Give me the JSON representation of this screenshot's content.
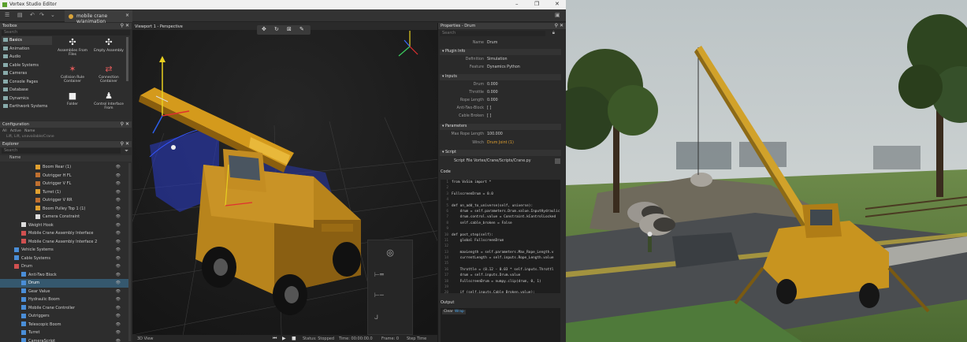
{
  "app": {
    "title": "Vortex Studio Editor",
    "window_controls": [
      "–",
      "❐",
      "✕"
    ]
  },
  "document_tab": {
    "label": "mobile crane w/animation",
    "close": "×"
  },
  "toolbox": {
    "title": "Toolbox",
    "search_placeholder": "Search",
    "categories": [
      "Basics",
      "Animation",
      "Audio",
      "Cable Systems",
      "Cameras",
      "Console Pages",
      "Database",
      "Dynamics",
      "Earthwork Systems"
    ],
    "items": [
      {
        "label": "Assemblies From Files"
      },
      {
        "label": "Empty Assembly"
      },
      {
        "label": "Collision Rule Container"
      },
      {
        "label": "Connection Container"
      },
      {
        "label": "Folder"
      },
      {
        "label": "Control Interface From"
      }
    ]
  },
  "configuration": {
    "title": "Configuration",
    "tabs": [
      "All",
      "Active",
      "Name"
    ],
    "row": "Lift, Lift, unavailable/Crane"
  },
  "explorer": {
    "title": "Explorer",
    "search_placeholder": "Search",
    "column_name": "Name",
    "rows": [
      {
        "label": "Boom Rear (1)",
        "indent": 5,
        "icon": "#e0a030"
      },
      {
        "label": "Outrigger H FL",
        "indent": 5,
        "icon": "#c07030"
      },
      {
        "label": "Outrigger V FL",
        "indent": 5,
        "icon": "#c07030"
      },
      {
        "label": "Turret (1)",
        "indent": 5,
        "icon": "#e0a030"
      },
      {
        "label": "Outrigger V RR",
        "indent": 5,
        "icon": "#c07030"
      },
      {
        "label": "Boom Pulley Top 1 (1)",
        "indent": 5,
        "icon": "#e0a030"
      },
      {
        "label": "Camera Constraint",
        "indent": 5,
        "icon": "#dddddd"
      },
      {
        "label": "Weight Hook",
        "indent": 3,
        "icon": "#dddddd"
      },
      {
        "label": "Mobile Crane Assembly Interface",
        "indent": 3,
        "icon": "#d05050"
      },
      {
        "label": "Mobile Crane Assembly Interface 2",
        "indent": 3,
        "icon": "#d05050"
      },
      {
        "label": "Vehicle Systems",
        "indent": 2,
        "icon": "#4a8ed8"
      },
      {
        "label": "Cable Systems",
        "indent": 2,
        "icon": "#4a8ed8"
      },
      {
        "label": "Drum",
        "indent": 2,
        "icon": "#d05050"
      },
      {
        "label": "Anti-Two Block",
        "indent": 3,
        "icon": "#4a8ed8"
      },
      {
        "label": "Drum",
        "indent": 3,
        "icon": "#4a8ed8",
        "selected": true
      },
      {
        "label": "Gear Value",
        "indent": 3,
        "icon": "#4a8ed8"
      },
      {
        "label": "Hydraulic Boom",
        "indent": 3,
        "icon": "#4a8ed8"
      },
      {
        "label": "Mobile Crane Controller",
        "indent": 3,
        "icon": "#4a8ed8"
      },
      {
        "label": "Outriggers",
        "indent": 3,
        "icon": "#4a8ed8"
      },
      {
        "label": "Telescopic Boom",
        "indent": 3,
        "icon": "#4a8ed8"
      },
      {
        "label": "Turret",
        "indent": 3,
        "icon": "#4a8ed8"
      },
      {
        "label": "CameraScript",
        "indent": 3,
        "icon": "#4a8ed8"
      },
      {
        "label": "Connection Containers",
        "indent": 2,
        "icon": "#4a8ed8"
      }
    ]
  },
  "viewport": {
    "title": "Viewport 1 - Perspective",
    "bottom": {
      "view": "3D View",
      "state": "Status: Stopped",
      "time": "Time: 00:00:00.0",
      "frame": "Frame: 0",
      "step": "Step Time"
    }
  },
  "properties": {
    "title": "Properties - Drum",
    "search_placeholder": "Search",
    "name_label": "Name",
    "name_value": "Drum",
    "sections": {
      "plugin_info": "Plugin Info",
      "inputs": "Inputs",
      "parameters": "Parameters",
      "script": "Script"
    },
    "plugin_rows": [
      {
        "k": "Definition",
        "v": "Simulation"
      },
      {
        "k": "Feature",
        "v": "Dynamics Python"
      }
    ],
    "input_rows": [
      {
        "k": "Drum",
        "v": "0.000"
      },
      {
        "k": "Throttle",
        "v": "0.000"
      },
      {
        "k": "Rope Length",
        "v": "0.000"
      },
      {
        "k": "Anti-Two-Block",
        "v": "[ ]"
      },
      {
        "k": "Cable Broken",
        "v": "[ ]"
      }
    ],
    "param_rows": [
      {
        "k": "Max Rope Length",
        "v": "100.000"
      },
      {
        "k": "Winch",
        "v": "Drum Joint (1)"
      }
    ],
    "script_path": "Script File  Vortex/Crane/Scripts/Crane.py",
    "code_title": "Code",
    "code_lines": [
      "from VxSim import *",
      "",
      "FullscreenDrum = 0.0",
      "",
      "def on_add_to_universe(self, universe):",
      "    drum = self.parameters.Drum.value.InputHydraulic",
      "    drum.control.value = Constraint.kControlLocked",
      "    self.cable_broken = False",
      "",
      "def post_step(self):",
      "    global FullscreenDrum",
      "",
      "    maxLength = self.parameters.Max_Rope_Length.v",
      "    currentLength = self.inputs.Rope_Length.value",
      "",
      "    Throttle = (0.12 - 0.03 * self.inputs.Throttl",
      "    drum = self.inputs.Drum.value",
      "    FullscreenDrum = numpy.clip(drum, 0, 1)",
      "",
      "    if (self.inputs.Cable_Broken.value):",
      "        self.cable_broken = True"
    ],
    "output_title": "Output",
    "output_buttons": [
      "Clear",
      "Wrap"
    ]
  }
}
